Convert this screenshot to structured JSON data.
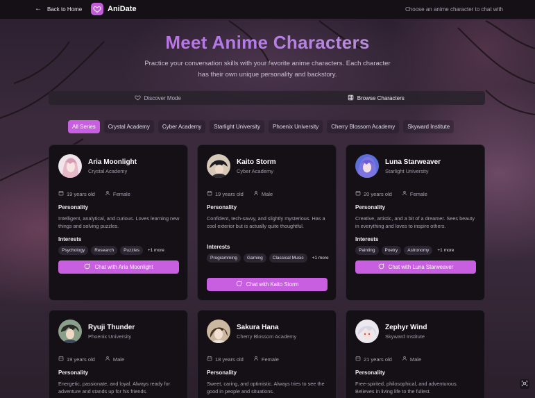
{
  "nav": {
    "back_label": "Back to Home",
    "brand": "AniDate",
    "tagline": "Choose an anime character to chat with"
  },
  "hero": {
    "title": "Meet Anime Characters",
    "subtitle": "Practice your conversation skills with your favorite anime characters. Each character has their own unique personality and backstory."
  },
  "modes": [
    {
      "label": "Discover Mode",
      "icon": "heart-icon"
    },
    {
      "label": "Browse Characters",
      "icon": "grid-icon"
    }
  ],
  "filters": [
    "All Series",
    "Crystal Academy",
    "Cyber Academy",
    "Starlight University",
    "Phoenix University",
    "Cherry Blossom Academy",
    "Skyward Institute"
  ],
  "labels": {
    "personality": "Personality",
    "interests": "Interests"
  },
  "characters": [
    {
      "name": "Aria Moonlight",
      "school": "Crystal Academy",
      "age": "19 years old",
      "gender": "Female",
      "personality": "Intelligent, analytical, and curious. Loves learning new things and solving puzzles.",
      "interests": [
        "Psychology",
        "Research",
        "Puzzles"
      ],
      "more": "+1 more",
      "chat_label": "Chat with Aria Moonlight",
      "avatar_color": "#e7c9d6"
    },
    {
      "name": "Kaito Storm",
      "school": "Cyber Academy",
      "age": "19 years old",
      "gender": "Male",
      "personality": "Confident, tech-savvy, and slightly mysterious. Has a cool exterior but is actually quite thoughtful.",
      "interests": [
        "Programming",
        "Gaming",
        "Classical Music"
      ],
      "more": "+1 more",
      "chat_label": "Chat with Kaito Storm",
      "avatar_color": "#2b2a2e"
    },
    {
      "name": "Luna Starweaver",
      "school": "Starlight University",
      "age": "20 years old",
      "gender": "Female",
      "personality": "Creative, artistic, and a bit of a dreamer. Sees beauty in everything and loves to inspire others.",
      "interests": [
        "Painting",
        "Poetry",
        "Astronomy"
      ],
      "more": "+1 more",
      "chat_label": "Chat with Luna Starweaver",
      "avatar_color": "#6a5fd0"
    },
    {
      "name": "Ryuji Thunder",
      "school": "Phoenix University",
      "age": "19 years old",
      "gender": "Male",
      "personality": "Energetic, passionate, and loyal. Always ready for adventure and stands up for his friends.",
      "avatar_color": "#3a4a3a"
    },
    {
      "name": "Sakura Hana",
      "school": "Cherry Blossom Academy",
      "age": "18 years old",
      "gender": "Female",
      "personality": "Sweet, caring, and optimistic. Always tries to see the good in people and situations.",
      "avatar_color": "#5a4a3a"
    },
    {
      "name": "Zephyr Wind",
      "school": "Skyward Institute",
      "age": "21 years old",
      "gender": "Male",
      "personality": "Free-spirited, philosophical, and adventurous. Believes in living life to the fullest.",
      "avatar_color": "#d8d4e0"
    }
  ],
  "colors": {
    "accent": "#c85ee0",
    "card_bg": "#141016",
    "page_bg": "#3a2a3c"
  }
}
